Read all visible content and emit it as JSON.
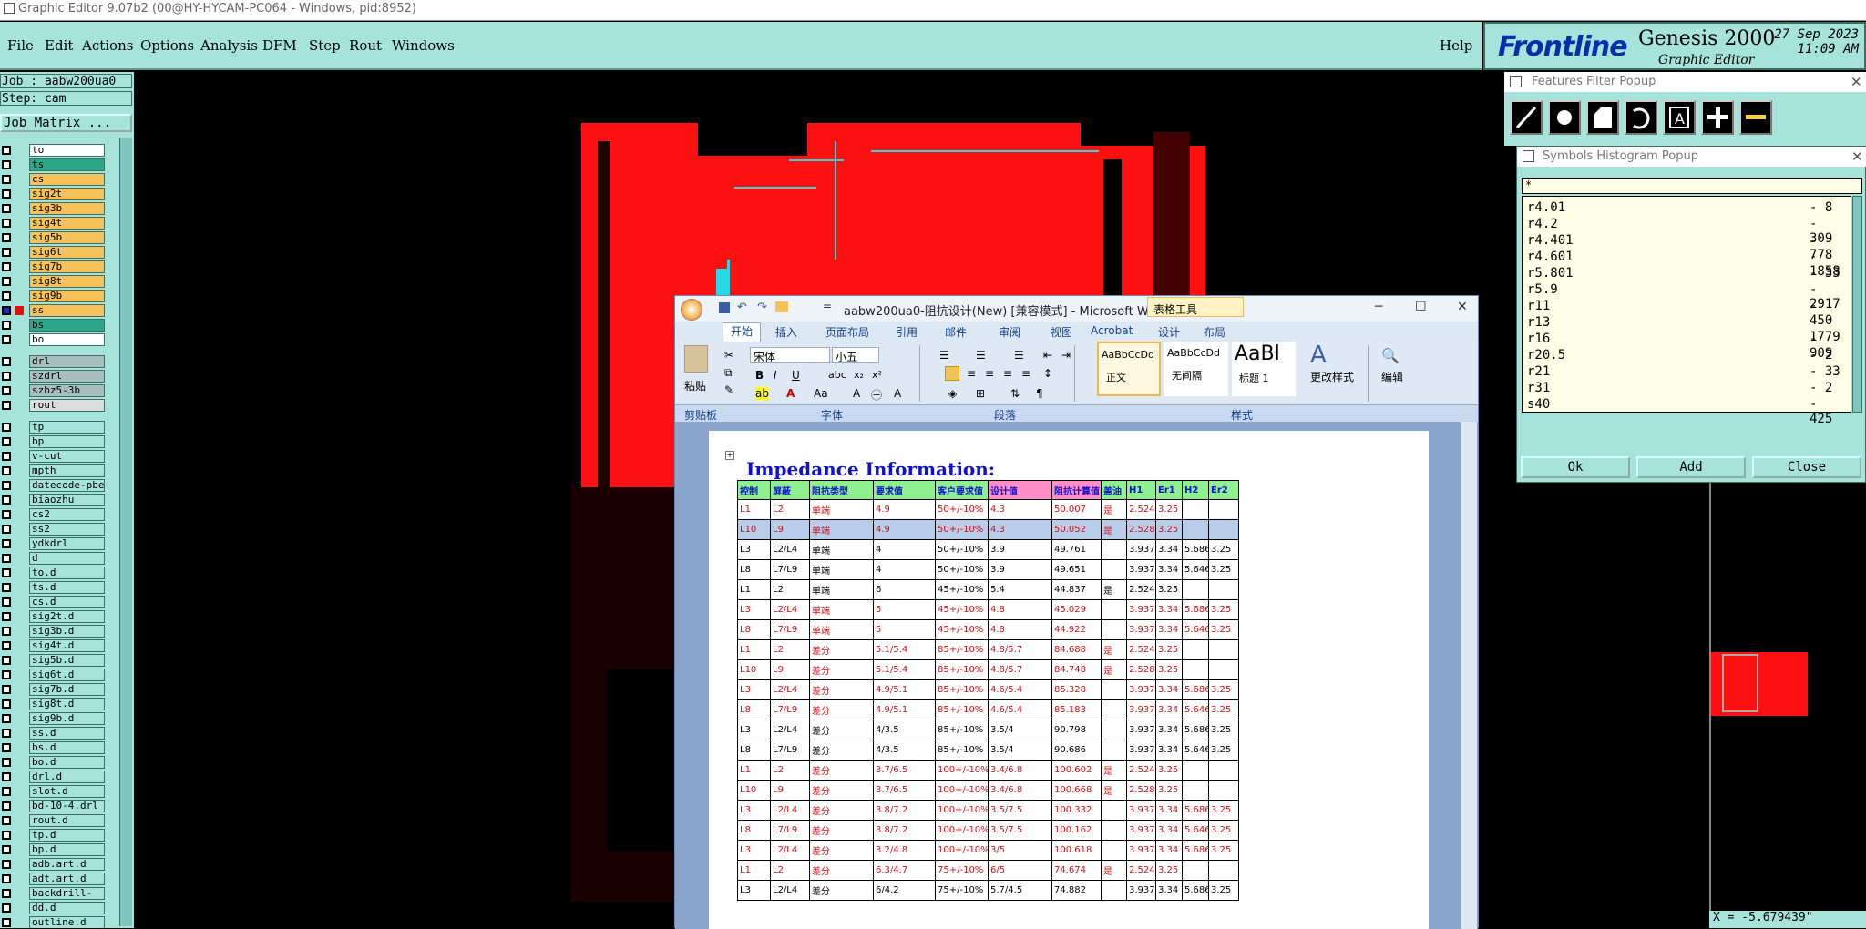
{
  "window_title": "Graphic Editor 9.07b2 (00@HY-HYCAM-PC064 - Windows, pid:8952)",
  "menu": {
    "file": "File",
    "edit": "Edit",
    "actions": "Actions",
    "options": "Options",
    "analysis": "Analysis",
    "dfm": "DFM",
    "step": "Step",
    "rout": "Rout",
    "windows": "Windows",
    "help": "Help"
  },
  "brand": {
    "logo": "Frontline",
    "product": "Genesis 2000",
    "subtitle": "Graphic Editor",
    "date": "27 Sep 2023",
    "time": "11:09 AM"
  },
  "job": {
    "job_line": "Job : aabw200ua0",
    "step_line": "Step: cam",
    "job_matrix": "Job Matrix ..."
  },
  "layers": [
    {
      "name": "to",
      "color": "#ffffff"
    },
    {
      "name": "ts",
      "color": "#2aa887"
    },
    {
      "name": "cs",
      "color": "#f7c25a"
    },
    {
      "name": "sig2t",
      "color": "#f7c25a"
    },
    {
      "name": "sig3b",
      "color": "#f7c25a"
    },
    {
      "name": "sig4t",
      "color": "#f7c25a"
    },
    {
      "name": "sig5b",
      "color": "#f7c25a"
    },
    {
      "name": "sig6t",
      "color": "#f7c25a"
    },
    {
      "name": "sig7b",
      "color": "#f7c25a"
    },
    {
      "name": "sig8t",
      "color": "#f7c25a"
    },
    {
      "name": "sig9b",
      "color": "#f7c25a"
    },
    {
      "name": "ss",
      "color": "#f7c25a"
    },
    {
      "name": "bs",
      "color": "#2aa887"
    },
    {
      "name": "bo",
      "color": "#ffffff"
    },
    {
      "name": "drl",
      "color": "#a9bfbf"
    },
    {
      "name": "szdrl",
      "color": "#a9bfbf"
    },
    {
      "name": "szbz5-3b",
      "color": "#a9bfbf"
    },
    {
      "name": "rout",
      "color": "#dddddd"
    },
    {
      "name": "tp",
      "color": "#a6e3db"
    },
    {
      "name": "bp",
      "color": "#a6e3db"
    },
    {
      "name": "v-cut",
      "color": "#a6e3db"
    },
    {
      "name": "mpth",
      "color": "#a6e3db"
    },
    {
      "name": "datecode-pbe",
      "color": "#a6e3db"
    },
    {
      "name": "biaozhu",
      "color": "#a6e3db"
    },
    {
      "name": "cs2",
      "color": "#a6e3db"
    },
    {
      "name": "ss2",
      "color": "#a6e3db"
    },
    {
      "name": "ydkdrl",
      "color": "#a6e3db"
    },
    {
      "name": "d",
      "color": "#a6e3db"
    },
    {
      "name": "to.d",
      "color": "#a6e3db"
    },
    {
      "name": "ts.d",
      "color": "#a6e3db"
    },
    {
      "name": "cs.d",
      "color": "#a6e3db"
    },
    {
      "name": "sig2t.d",
      "color": "#a6e3db"
    },
    {
      "name": "sig3b.d",
      "color": "#a6e3db"
    },
    {
      "name": "sig4t.d",
      "color": "#a6e3db"
    },
    {
      "name": "sig5b.d",
      "color": "#a6e3db"
    },
    {
      "name": "sig6t.d",
      "color": "#a6e3db"
    },
    {
      "name": "sig7b.d",
      "color": "#a6e3db"
    },
    {
      "name": "sig8t.d",
      "color": "#a6e3db"
    },
    {
      "name": "sig9b.d",
      "color": "#a6e3db"
    },
    {
      "name": "ss.d",
      "color": "#a6e3db"
    },
    {
      "name": "bs.d",
      "color": "#a6e3db"
    },
    {
      "name": "bo.d",
      "color": "#a6e3db"
    },
    {
      "name": "drl.d",
      "color": "#a6e3db"
    },
    {
      "name": "slot.d",
      "color": "#a6e3db"
    },
    {
      "name": "bd-10-4.drl",
      "color": "#a6e3db"
    },
    {
      "name": "rout.d",
      "color": "#a6e3db"
    },
    {
      "name": "tp.d",
      "color": "#a6e3db"
    },
    {
      "name": "bp.d",
      "color": "#a6e3db"
    },
    {
      "name": "adb.art.d",
      "color": "#a6e3db"
    },
    {
      "name": "adt.art.d",
      "color": "#a6e3db"
    },
    {
      "name": "backdrill-",
      "color": "#a6e3db"
    },
    {
      "name": "dd.d",
      "color": "#a6e3db"
    },
    {
      "name": "outline.d",
      "color": "#a6e3db"
    }
  ],
  "word": {
    "title": "aabw200ua0-阻抗设计(New) [兼容模式] - Microsoft W...",
    "table_tools": "表格工具",
    "tabs": [
      "开始",
      "插入",
      "页面布局",
      "引用",
      "邮件",
      "审阅",
      "视图",
      "Acrobat",
      "设计",
      "布局"
    ],
    "font_name": "宋体",
    "font_size": "小五",
    "styles": [
      "AaBbCcDd",
      "AaBbCcDd",
      "AaBl"
    ],
    "style_names": [
      "正文",
      "无间隔",
      "标题 1"
    ],
    "change_styles": "更改样式",
    "edit": "编辑",
    "paste": "粘贴",
    "groups": [
      "剪贴板",
      "字体",
      "段落",
      "样式"
    ],
    "heading": "Impedance Information:",
    "columns": [
      "控制",
      "屏蔽",
      "阻抗类型",
      "要求值",
      "客户要求值",
      "设计值",
      "阻抗计算值",
      "盖油",
      "H1",
      "Er1",
      "H2",
      "Er2"
    ],
    "rows": [
      [
        "L1",
        "L2",
        "单端",
        "4.9",
        "50+/-10%",
        "4.3",
        "50.007",
        "是",
        "2.524",
        "3.25",
        "",
        ""
      ],
      [
        "L10",
        "L9",
        "单端",
        "4.9",
        "50+/-10%",
        "4.3",
        "50.052",
        "是",
        "2.528",
        "3.25",
        "",
        ""
      ],
      [
        "L3",
        "L2/L4",
        "单端",
        "4",
        "50+/-10%",
        "3.9",
        "49.761",
        "",
        "3.937",
        "3.34",
        "5.686",
        "3.25"
      ],
      [
        "L8",
        "L7/L9",
        "单端",
        "4",
        "50+/-10%",
        "3.9",
        "49.651",
        "",
        "3.937",
        "3.34",
        "5.646",
        "3.25"
      ],
      [
        "L1",
        "L2",
        "单端",
        "6",
        "45+/-10%",
        "5.4",
        "44.837",
        "是",
        "2.524",
        "3.25",
        "",
        ""
      ],
      [
        "L3",
        "L2/L4",
        "单端",
        "5",
        "45+/-10%",
        "4.8",
        "45.029",
        "",
        "3.937",
        "3.34",
        "5.686",
        "3.25"
      ],
      [
        "L8",
        "L7/L9",
        "单端",
        "5",
        "45+/-10%",
        "4.8",
        "44.922",
        "",
        "3.937",
        "3.34",
        "5.646",
        "3.25"
      ],
      [
        "L1",
        "L2",
        "差分",
        "5.1/5.4",
        "85+/-10%",
        "4.8/5.7",
        "84.688",
        "是",
        "2.524",
        "3.25",
        "",
        ""
      ],
      [
        "L10",
        "L9",
        "差分",
        "5.1/5.4",
        "85+/-10%",
        "4.8/5.7",
        "84.748",
        "是",
        "2.528",
        "3.25",
        "",
        ""
      ],
      [
        "L3",
        "L2/L4",
        "差分",
        "4.9/5.1",
        "85+/-10%",
        "4.6/5.4",
        "85.328",
        "",
        "3.937",
        "3.34",
        "5.686",
        "3.25"
      ],
      [
        "L8",
        "L7/L9",
        "差分",
        "4.9/5.1",
        "85+/-10%",
        "4.6/5.4",
        "85.183",
        "",
        "3.937",
        "3.34",
        "5.646",
        "3.25"
      ],
      [
        "L3",
        "L2/L4",
        "差分",
        "4/3.5",
        "85+/-10%",
        "3.5/4",
        "90.798",
        "",
        "3.937",
        "3.34",
        "5.686",
        "3.25"
      ],
      [
        "L8",
        "L7/L9",
        "差分",
        "4/3.5",
        "85+/-10%",
        "3.5/4",
        "90.686",
        "",
        "3.937",
        "3.34",
        "5.646",
        "3.25"
      ],
      [
        "L1",
        "L2",
        "差分",
        "3.7/6.5",
        "100+/-10%",
        "3.4/6.8",
        "100.602",
        "是",
        "2.524",
        "3.25",
        "",
        ""
      ],
      [
        "L10",
        "L9",
        "差分",
        "3.7/6.5",
        "100+/-10%",
        "3.4/6.8",
        "100.668",
        "是",
        "2.528",
        "3.25",
        "",
        ""
      ],
      [
        "L3",
        "L2/L4",
        "差分",
        "3.8/7.2",
        "100+/-10%",
        "3.5/7.5",
        "100.332",
        "",
        "3.937",
        "3.34",
        "5.686",
        "3.25"
      ],
      [
        "L8",
        "L7/L9",
        "差分",
        "3.8/7.2",
        "100+/-10%",
        "3.5/7.5",
        "100.162",
        "",
        "3.937",
        "3.34",
        "5.646",
        "3.25"
      ],
      [
        "L3",
        "L2/L4",
        "差分",
        "3.2/4.8",
        "100+/-10%",
        "3/5",
        "100.618",
        "",
        "3.937",
        "3.34",
        "5.686",
        "3.25"
      ],
      [
        "L1",
        "L2",
        "差分",
        "6.3/4.7",
        "75+/-10%",
        "6/5",
        "74.674",
        "是",
        "2.524",
        "3.25",
        "",
        ""
      ],
      [
        "L3",
        "L2/L4",
        "差分",
        "6/4.2",
        "75+/-10%",
        "5.7/4.5",
        "74.882",
        "",
        "3.937",
        "3.34",
        "5.686",
        "3.25"
      ]
    ],
    "red_rows": [
      0,
      1,
      5,
      6,
      7,
      8,
      9,
      10,
      13,
      14,
      15,
      16,
      17,
      18
    ],
    "selected_row": 1
  },
  "features_filter": {
    "title": "Features Filter Popup"
  },
  "symbols_histogram": {
    "title": "Symbols Histogram Popup",
    "filter": "*",
    "items": [
      [
        "r4.01",
        "- 8"
      ],
      [
        "r4.2",
        "- 309"
      ],
      [
        "r4.401",
        "- 778"
      ],
      [
        "r4.601",
        "- 1858"
      ],
      [
        "r5.801",
        "- 33"
      ],
      [
        "r5.9",
        "- 2917"
      ],
      [
        "r11",
        "- 450"
      ],
      [
        "r13",
        "- 1779"
      ],
      [
        "r16",
        "- 909"
      ],
      [
        "r20.5",
        "- 2"
      ],
      [
        "r21",
        "- 33"
      ],
      [
        "r31",
        "- 2"
      ],
      [
        "s40",
        "- 425"
      ]
    ],
    "ok": "Ok",
    "add": "Add",
    "close": "Close"
  },
  "coord": "X = -5.679439\""
}
